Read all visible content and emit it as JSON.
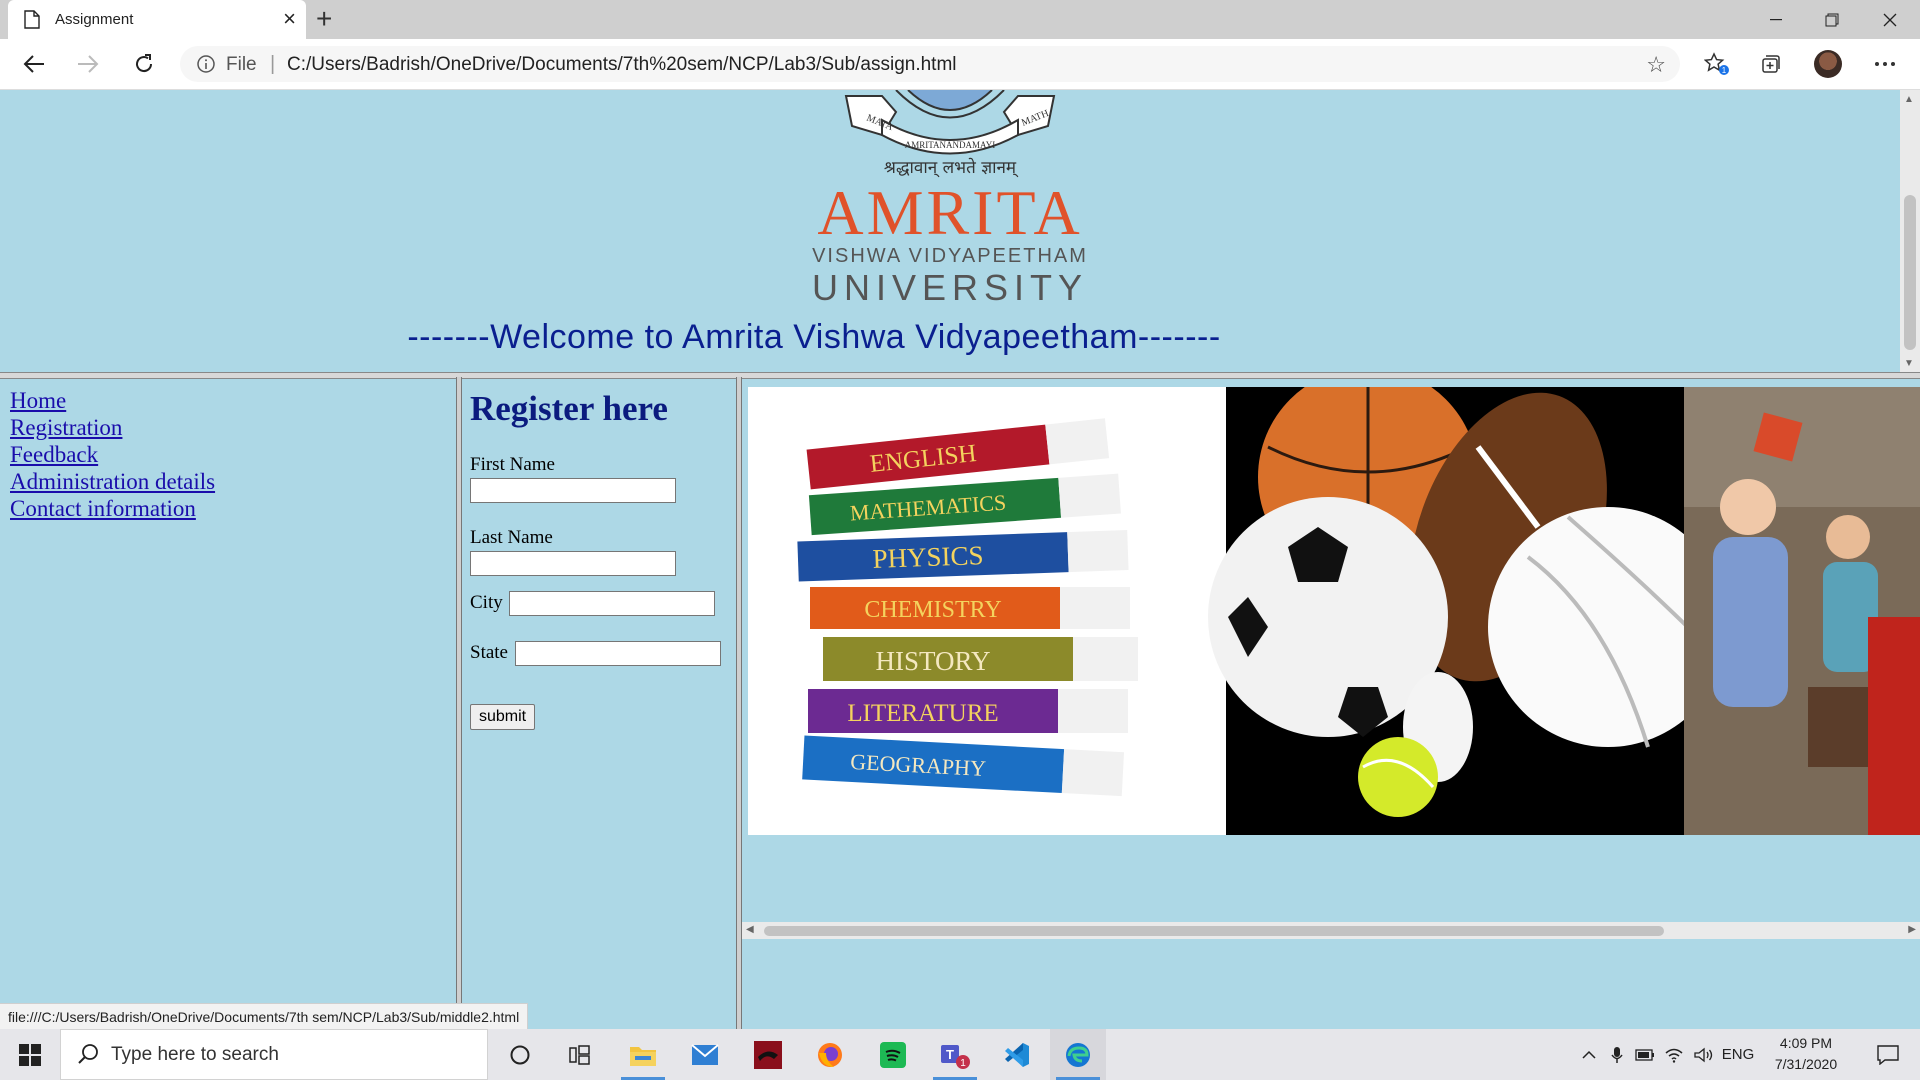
{
  "browser": {
    "tab_title": "Assignment",
    "protocol_label": "File",
    "address": "C:/Users/Badrish/OneDrive/Documents/7th%20sem/NCP/Lab3/Sub/assign.html",
    "status_url": "file:///C:/Users/Badrish/OneDrive/Documents/7th sem/NCP/Lab3/Sub/middle2.html",
    "favorites_badge": "1"
  },
  "header": {
    "logo": {
      "seal_left": "MATA",
      "seal_mid": "AMRITANANDAMAYI",
      "seal_right": "MATH",
      "motto": "श्रद्धावान् लभते ज्ञानम्",
      "name": "AMRITA",
      "line1": "VISHWA VIDYAPEETHAM",
      "line2": "UNIVERSITY"
    },
    "welcome": "-------Welcome to Amrita Vishwa Vidyapeetham-------"
  },
  "nav": {
    "links": [
      "Home",
      "Registration",
      "Feedback",
      "Administration details",
      "Contact information"
    ]
  },
  "form": {
    "heading": "Register here",
    "first_name_label": "First Name",
    "last_name_label": "Last Name",
    "city_label": "City",
    "state_label": "State",
    "first_name_value": "",
    "last_name_value": "",
    "city_value": "",
    "state_value": "",
    "submit_label": "submit"
  },
  "banner": {
    "books": [
      "ENGLISH",
      "MATHEMATICS",
      "PHYSICS",
      "CHEMISTRY",
      "HISTORY",
      "LITERATURE",
      "GEOGRAPHY"
    ]
  },
  "taskbar": {
    "search_placeholder": "Type here to search",
    "teams_badge": "1",
    "language": "ENG",
    "time": "4:09 PM",
    "date": "7/31/2020"
  },
  "colors": {
    "page_bg": "#add8e6",
    "welcome_text": "#0a1f8f",
    "heading_text": "#0b1b7f",
    "link_text": "#1a0dab",
    "amrita_orange": "#e0522a"
  }
}
